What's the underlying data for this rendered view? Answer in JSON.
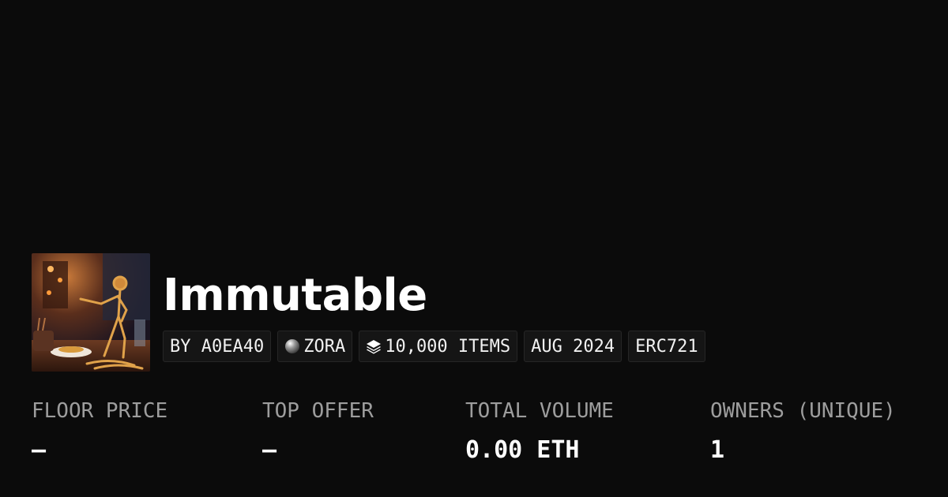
{
  "collection": {
    "title": "Immutable",
    "avatar_alt": "collection-artwork"
  },
  "badges": [
    {
      "icon": "",
      "label": "BY A0EA40"
    },
    {
      "icon": "zora-sphere-icon",
      "label": "ZORA"
    },
    {
      "icon": "layers-icon",
      "label": "10,000 ITEMS"
    },
    {
      "icon": "",
      "label": "AUG 2024"
    },
    {
      "icon": "",
      "label": "ERC721"
    }
  ],
  "stats": [
    {
      "label": "FLOOR PRICE",
      "value": "—"
    },
    {
      "label": "TOP OFFER",
      "value": "—"
    },
    {
      "label": "TOTAL VOLUME",
      "value": "0.00 ETH"
    },
    {
      "label": "OWNERS (UNIQUE)",
      "value": "1"
    }
  ],
  "colors": {
    "background": "#0b0b0b",
    "badge_bg": "#151515",
    "label_gray": "#9d9d9d"
  }
}
